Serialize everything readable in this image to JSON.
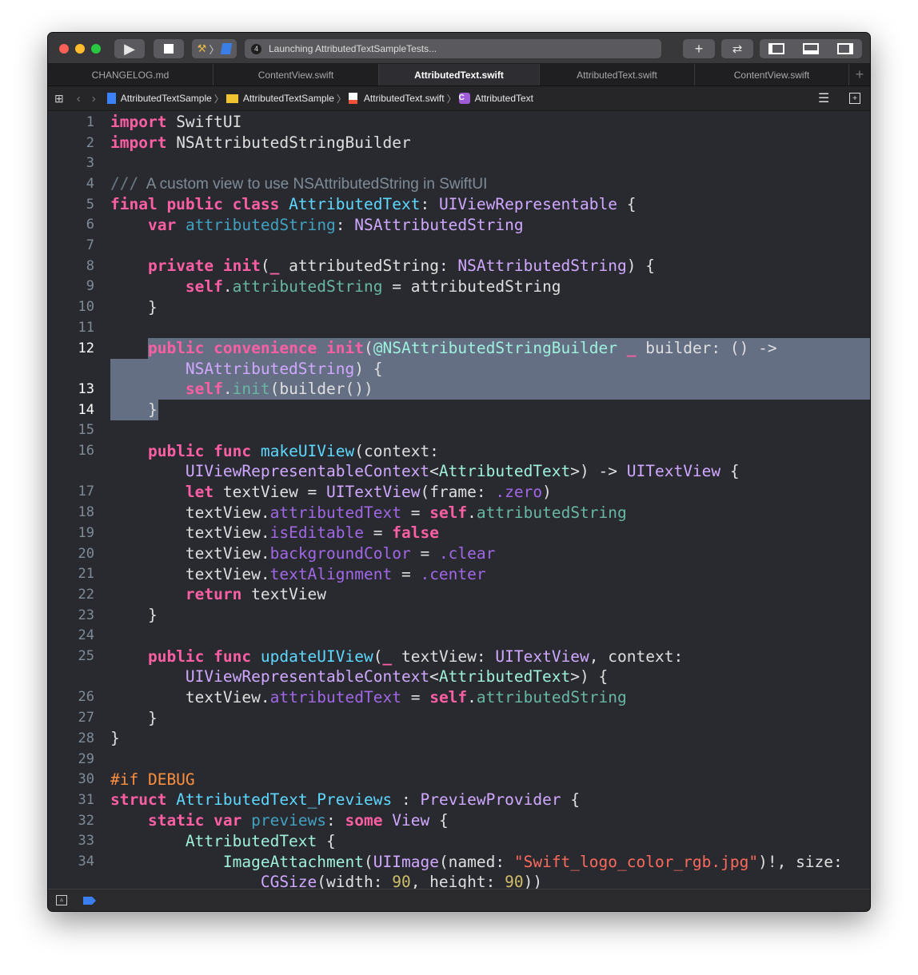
{
  "toolbar": {
    "status_count": "4",
    "status_text": "Launching AttributedTextSampleTests...",
    "icons": [
      "run-icon",
      "stop-icon",
      "scheme-icon",
      "library-plus-icon",
      "code-review-icon",
      "navigator-toggle-icon",
      "debug-area-toggle-icon",
      "inspector-toggle-icon"
    ]
  },
  "tabs": [
    {
      "label": "CHANGELOG.md"
    },
    {
      "label": "ContentView.swift"
    },
    {
      "label": "AttributedText.swift",
      "active": true
    },
    {
      "label": "AttributedText.swift"
    },
    {
      "label": "ContentView.swift"
    }
  ],
  "breadcrumb": [
    "AttributedTextSample",
    "AttributedTextSample",
    "AttributedText.swift",
    "AttributedText"
  ],
  "colors": {
    "keyword": "#fc5fa3",
    "system_type": "#d0a8ff",
    "declaration": "#5dd8ff",
    "project_type": "#9ef1dd",
    "string": "#fc6a5d",
    "number": "#d0bf69",
    "preprocessor": "#fd8f3f",
    "selection": "#646f83",
    "background": "#292a30"
  },
  "code": [
    {
      "n": "1",
      "t": [
        [
          "kw",
          "import"
        ],
        [
          "pl",
          " SwiftUI"
        ]
      ]
    },
    {
      "n": "2",
      "t": [
        [
          "kw",
          "import"
        ],
        [
          "pl",
          " NSAttributedStringBuilder"
        ]
      ]
    },
    {
      "n": "3",
      "t": []
    },
    {
      "n": "4",
      "t": [
        [
          "cm",
          "///"
        ],
        [
          "doc",
          "  A custom view to use NSAttributedString in SwiftUI"
        ]
      ]
    },
    {
      "n": "5",
      "t": [
        [
          "kw",
          "final public class"
        ],
        [
          "pl",
          " "
        ],
        [
          "dc",
          "AttributedText"
        ],
        [
          "pl",
          ": "
        ],
        [
          "ty",
          "UIViewRepresentable"
        ],
        [
          "pl",
          " {"
        ]
      ]
    },
    {
      "n": "6",
      "t": [
        [
          "pl",
          "    "
        ],
        [
          "kw",
          "var"
        ],
        [
          "pl",
          " "
        ],
        [
          "pd",
          "attributedString"
        ],
        [
          "pl",
          ": "
        ],
        [
          "ty",
          "NSAttributedString"
        ]
      ]
    },
    {
      "n": "7",
      "t": []
    },
    {
      "n": "8",
      "t": [
        [
          "pl",
          "    "
        ],
        [
          "kw",
          "private init"
        ],
        [
          "pl",
          "("
        ],
        [
          "kw",
          "_"
        ],
        [
          "pl",
          " attributedString: "
        ],
        [
          "ty",
          "NSAttributedString"
        ],
        [
          "pl",
          ") {"
        ]
      ]
    },
    {
      "n": "9",
      "t": [
        [
          "pl",
          "        "
        ],
        [
          "kw",
          "self"
        ],
        [
          "pl",
          "."
        ],
        [
          "pm",
          "attributedString"
        ],
        [
          "pl",
          " = attributedString"
        ]
      ]
    },
    {
      "n": "10",
      "t": [
        [
          "pl",
          "    }"
        ]
      ]
    },
    {
      "n": "11",
      "t": []
    },
    {
      "n": "12",
      "t": [
        [
          "pl",
          "    "
        ],
        [
          "kw",
          "public convenience init"
        ],
        [
          "pl",
          "("
        ],
        [
          "pt",
          "@NSAttributedStringBuilder"
        ],
        [
          "pl",
          " "
        ],
        [
          "kw",
          "_"
        ],
        [
          "pl",
          " builder: () ->"
        ]
      ]
    },
    {
      "n": "",
      "t": [
        [
          "pl",
          "        "
        ],
        [
          "ty",
          "NSAttributedString"
        ],
        [
          "pl",
          ") {"
        ]
      ]
    },
    {
      "n": "13",
      "t": [
        [
          "pl",
          "        "
        ],
        [
          "kw",
          "self"
        ],
        [
          "pl",
          "."
        ],
        [
          "pm",
          "init"
        ],
        [
          "pl",
          "(builder())"
        ]
      ]
    },
    {
      "n": "14",
      "t": [
        [
          "pl",
          "    }"
        ]
      ]
    },
    {
      "n": "15",
      "t": []
    },
    {
      "n": "16",
      "t": [
        [
          "pl",
          "    "
        ],
        [
          "kw",
          "public func"
        ],
        [
          "pl",
          " "
        ],
        [
          "dc",
          "makeUIView"
        ],
        [
          "pl",
          "(context:"
        ]
      ]
    },
    {
      "n": "",
      "t": [
        [
          "pl",
          "        "
        ],
        [
          "ty",
          "UIViewRepresentableContext"
        ],
        [
          "pl",
          "<"
        ],
        [
          "pt",
          "AttributedText"
        ],
        [
          "pl",
          ">) -> "
        ],
        [
          "ty",
          "UITextView"
        ],
        [
          "pl",
          " {"
        ]
      ]
    },
    {
      "n": "17",
      "t": [
        [
          "pl",
          "        "
        ],
        [
          "kw",
          "let"
        ],
        [
          "pl",
          " textView = "
        ],
        [
          "ty",
          "UITextView"
        ],
        [
          "pl",
          "(frame: "
        ],
        [
          "sm",
          ".zero"
        ],
        [
          "pl",
          ")"
        ]
      ]
    },
    {
      "n": "18",
      "t": [
        [
          "pl",
          "        textView."
        ],
        [
          "sm",
          "attributedText"
        ],
        [
          "pl",
          " = "
        ],
        [
          "kw",
          "self"
        ],
        [
          "pl",
          "."
        ],
        [
          "pm",
          "attributedString"
        ]
      ]
    },
    {
      "n": "19",
      "t": [
        [
          "pl",
          "        textView."
        ],
        [
          "sm",
          "isEditable"
        ],
        [
          "pl",
          " = "
        ],
        [
          "kw",
          "false"
        ]
      ]
    },
    {
      "n": "20",
      "t": [
        [
          "pl",
          "        textView."
        ],
        [
          "sm",
          "backgroundColor"
        ],
        [
          "pl",
          " = "
        ],
        [
          "sm",
          ".clear"
        ]
      ]
    },
    {
      "n": "21",
      "t": [
        [
          "pl",
          "        textView."
        ],
        [
          "sm",
          "textAlignment"
        ],
        [
          "pl",
          " = "
        ],
        [
          "sm",
          ".center"
        ]
      ]
    },
    {
      "n": "22",
      "t": [
        [
          "pl",
          "        "
        ],
        [
          "kw",
          "return"
        ],
        [
          "pl",
          " textView"
        ]
      ]
    },
    {
      "n": "23",
      "t": [
        [
          "pl",
          "    }"
        ]
      ]
    },
    {
      "n": "24",
      "t": []
    },
    {
      "n": "25",
      "t": [
        [
          "pl",
          "    "
        ],
        [
          "kw",
          "public func"
        ],
        [
          "pl",
          " "
        ],
        [
          "dc",
          "updateUIView"
        ],
        [
          "pl",
          "("
        ],
        [
          "kw",
          "_"
        ],
        [
          "pl",
          " textView: "
        ],
        [
          "ty",
          "UITextView"
        ],
        [
          "pl",
          ", context:"
        ]
      ]
    },
    {
      "n": "",
      "t": [
        [
          "pl",
          "        "
        ],
        [
          "ty",
          "UIViewRepresentableContext"
        ],
        [
          "pl",
          "<"
        ],
        [
          "pt",
          "AttributedText"
        ],
        [
          "pl",
          ">) {"
        ]
      ]
    },
    {
      "n": "26",
      "t": [
        [
          "pl",
          "        textView."
        ],
        [
          "sm",
          "attributedText"
        ],
        [
          "pl",
          " = "
        ],
        [
          "kw",
          "self"
        ],
        [
          "pl",
          "."
        ],
        [
          "pm",
          "attributedString"
        ]
      ]
    },
    {
      "n": "27",
      "t": [
        [
          "pl",
          "    }"
        ]
      ]
    },
    {
      "n": "28",
      "t": [
        [
          "pl",
          "}"
        ]
      ]
    },
    {
      "n": "29",
      "t": []
    },
    {
      "n": "30",
      "t": [
        [
          "pp",
          "#if DEBUG"
        ]
      ]
    },
    {
      "n": "31",
      "t": [
        [
          "kw",
          "struct"
        ],
        [
          "pl",
          " "
        ],
        [
          "dc",
          "AttributedText_Previews"
        ],
        [
          "pl",
          " : "
        ],
        [
          "ty",
          "PreviewProvider"
        ],
        [
          "pl",
          " {"
        ]
      ]
    },
    {
      "n": "32",
      "t": [
        [
          "pl",
          "    "
        ],
        [
          "kw",
          "static var"
        ],
        [
          "pl",
          " "
        ],
        [
          "pd",
          "previews"
        ],
        [
          "pl",
          ": "
        ],
        [
          "kw",
          "some"
        ],
        [
          "pl",
          " "
        ],
        [
          "ty",
          "View"
        ],
        [
          "pl",
          " {"
        ]
      ]
    },
    {
      "n": "33",
      "t": [
        [
          "pl",
          "        "
        ],
        [
          "pt",
          "AttributedText"
        ],
        [
          "pl",
          " {"
        ]
      ]
    },
    {
      "n": "34",
      "t": [
        [
          "pl",
          "            "
        ],
        [
          "pt",
          "ImageAttachment"
        ],
        [
          "pl",
          "("
        ],
        [
          "ty",
          "UIImage"
        ],
        [
          "pl",
          "(named: "
        ],
        [
          "str",
          "\"Swift_logo_color_rgb.jpg\""
        ],
        [
          "pl",
          ")!, size:"
        ]
      ]
    },
    {
      "n": "",
      "t": [
        [
          "pl",
          "                "
        ],
        [
          "ty",
          "CGSize"
        ],
        [
          "pl",
          "(width: "
        ],
        [
          "num",
          "90"
        ],
        [
          "pl",
          ", height: "
        ],
        [
          "num",
          "90"
        ],
        [
          "pl",
          "))"
        ]
      ]
    }
  ]
}
